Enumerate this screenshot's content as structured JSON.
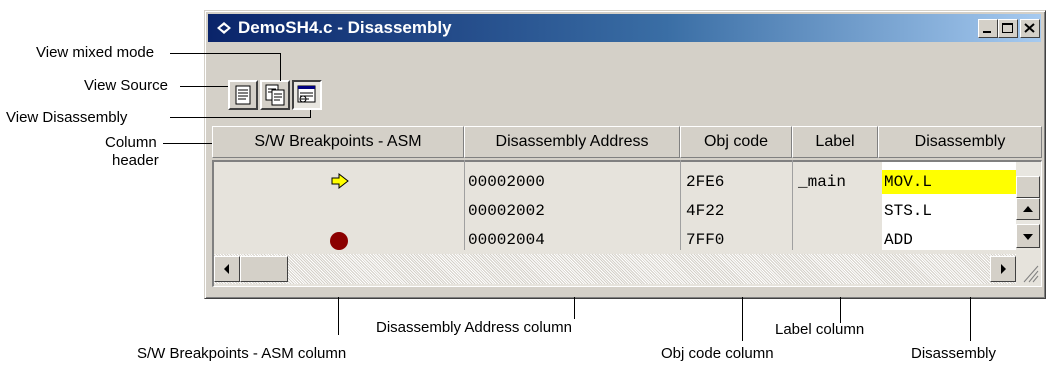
{
  "window": {
    "title": "DemoSH4.c - Disassembly",
    "controls": {
      "minimize": "_",
      "maximize": "□",
      "close": "✕"
    }
  },
  "toolbar": {
    "buttons": [
      {
        "icon": "source-document-icon"
      },
      {
        "icon": "mixed-mode-icon"
      },
      {
        "icon": "disassembly-view-icon",
        "pressed": true
      }
    ]
  },
  "columns": [
    "S/W Breakpoints - ASM",
    "Disassembly Address",
    "Obj code",
    "Label",
    "Disassembly"
  ],
  "rows": [
    {
      "marker": "pc-arrow",
      "address": "00002000",
      "obj": "2FE6",
      "label": "_main",
      "instr": "MOV.L",
      "highlight": true
    },
    {
      "marker": "",
      "address": "00002002",
      "obj": "4F22",
      "label": "",
      "instr": "STS.L",
      "highlight": false
    },
    {
      "marker": "breakpoint",
      "address": "00002004",
      "obj": "7FF0",
      "label": "",
      "instr": "ADD",
      "highlight": false
    }
  ],
  "callouts": {
    "view_mixed_mode": "View mixed mode",
    "view_source": "View Source",
    "view_disassembly": "View Disassembly",
    "column_header_line1": "Column",
    "column_header_line2": "header",
    "breakpoints_col": "S/W Breakpoints - ASM column",
    "address_col": "Disassembly Address column",
    "obj_col": "Obj code column",
    "label_col": "Label column",
    "disasm_col": "Disassembly"
  },
  "colors": {
    "titlebar_start": "#0a246a",
    "titlebar_end": "#a6caf0",
    "highlight": "#ffff00",
    "breakpoint": "#8b0000",
    "arrow": "#ffff00"
  }
}
